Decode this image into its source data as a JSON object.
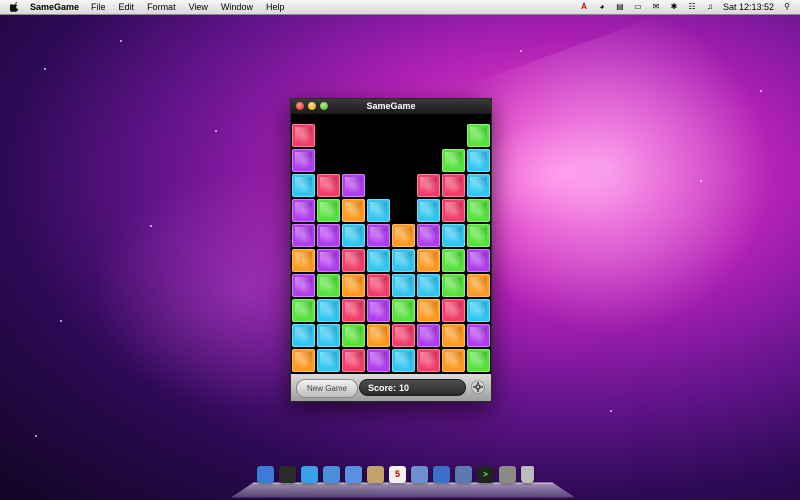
{
  "menubar": {
    "app_name": "SameGame",
    "menus": [
      "File",
      "Edit",
      "Format",
      "View",
      "Window",
      "Help"
    ],
    "clock": "Sat 12:13:52"
  },
  "window": {
    "title": "SameGame",
    "new_game_label": "New Game",
    "score_label": "Score:",
    "score_value": "10"
  },
  "colors": {
    "red": "#f23d6a",
    "green": "#56e23a",
    "blue": "#2fc6f2",
    "purple": "#b13cf0",
    "orange": "#ff9a1e"
  },
  "board": {
    "columns": 8,
    "rows": 10,
    "grid": [
      [
        "R",
        "",
        "",
        "",
        "",
        "",
        "",
        "G"
      ],
      [
        "P",
        "",
        "",
        "",
        "",
        "",
        "G",
        "B"
      ],
      [
        "B",
        "R",
        "P",
        "",
        "",
        "R",
        "R",
        "B"
      ],
      [
        "P",
        "G",
        "O",
        "B",
        "",
        "B",
        "R",
        "G"
      ],
      [
        "P",
        "P",
        "B",
        "P",
        "O",
        "P",
        "B",
        "G"
      ],
      [
        "O",
        "P",
        "R",
        "B",
        "B",
        "O",
        "G",
        "P"
      ],
      [
        "P",
        "G",
        "O",
        "R",
        "B",
        "B",
        "G",
        "O"
      ],
      [
        "G",
        "B",
        "R",
        "P",
        "G",
        "O",
        "R",
        "B"
      ],
      [
        "B",
        "B",
        "G",
        "O",
        "R",
        "P",
        "O",
        "P"
      ],
      [
        "O",
        "B",
        "R",
        "P",
        "B",
        "R",
        "O",
        "G"
      ]
    ]
  },
  "dock": {
    "icons": [
      "finder-icon",
      "dashboard-icon",
      "safari-icon",
      "mail-icon",
      "ichat-icon",
      "address-book-icon",
      "ical-icon",
      "preview-icon",
      "itunes-icon",
      "iphoto-icon",
      "terminal-icon",
      "system-preferences-icon",
      "trash-icon"
    ]
  }
}
